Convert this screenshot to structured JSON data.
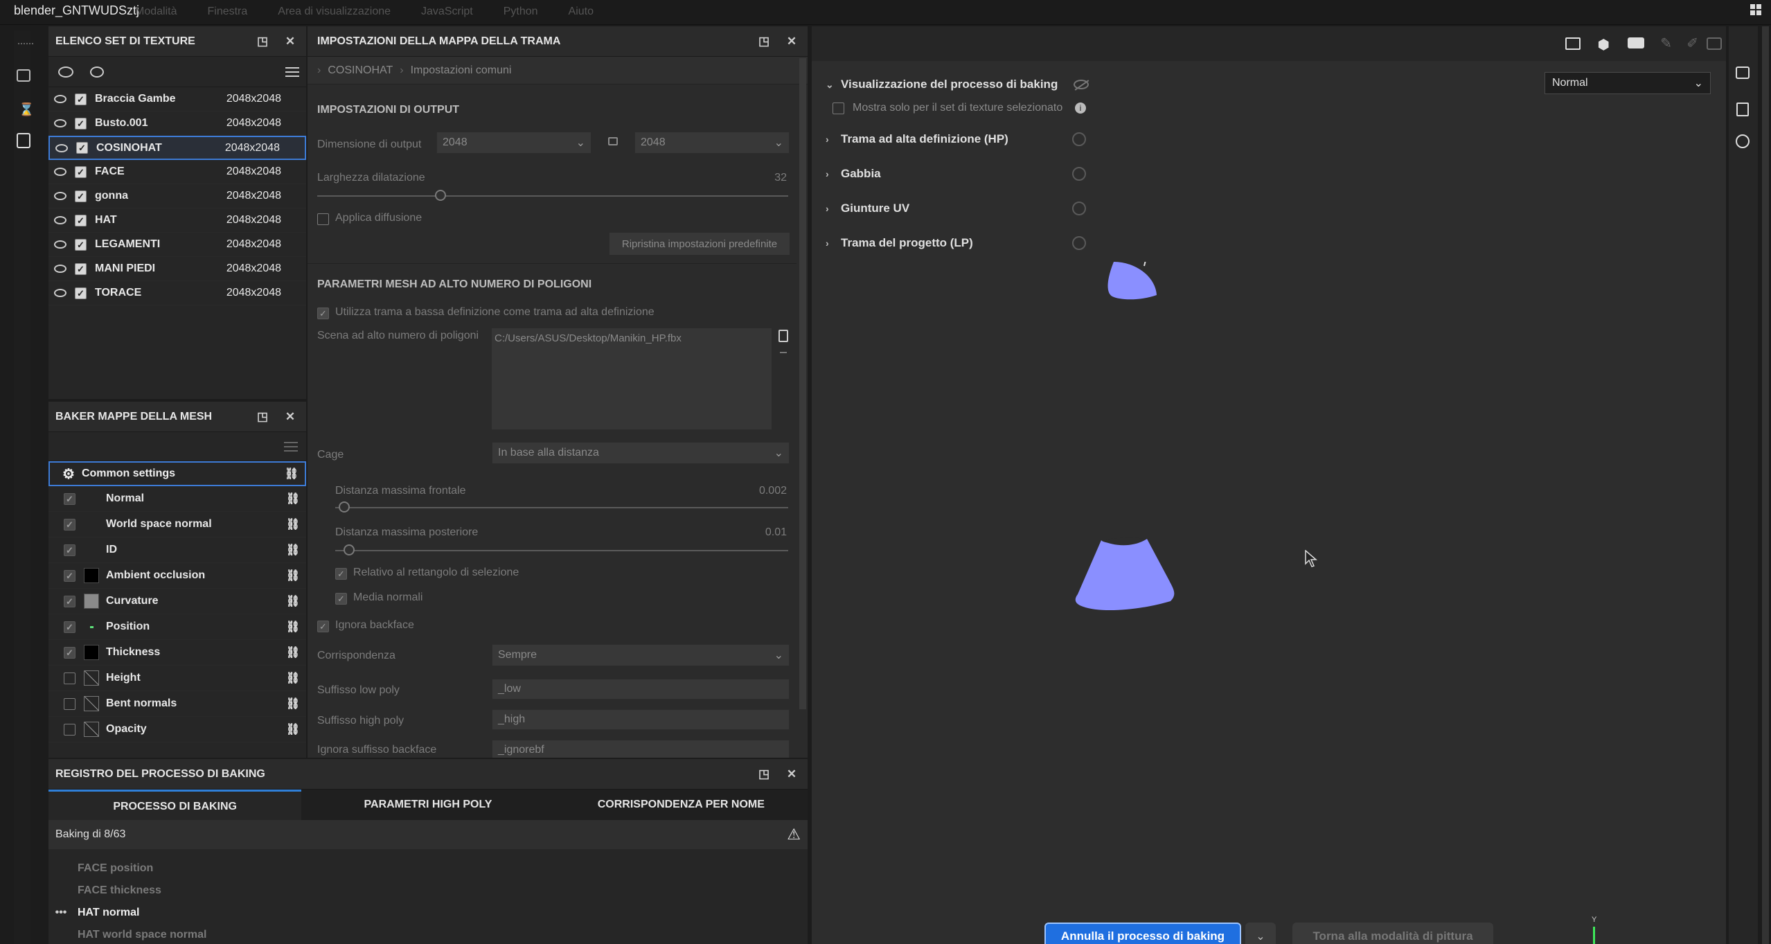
{
  "window": {
    "title": "blender_GNTWUDSztj",
    "menu": [
      "Modalità",
      "Finestra",
      "Area di visualizzazione",
      "JavaScript",
      "Python",
      "Aiuto"
    ]
  },
  "texture_sets": {
    "title": "ELENCO SET DI TEXTURE",
    "items": [
      {
        "name": "Braccia Gambe",
        "res": "2048x2048",
        "selected": false
      },
      {
        "name": "Busto.001",
        "res": "2048x2048",
        "selected": false
      },
      {
        "name": "COSINOHAT",
        "res": "2048x2048",
        "selected": true
      },
      {
        "name": "FACE",
        "res": "2048x2048",
        "selected": false
      },
      {
        "name": "gonna",
        "res": "2048x2048",
        "selected": false
      },
      {
        "name": "HAT",
        "res": "2048x2048",
        "selected": false
      },
      {
        "name": "LEGAMENTI",
        "res": "2048x2048",
        "selected": false
      },
      {
        "name": "MANI PIEDI",
        "res": "2048x2048",
        "selected": false
      },
      {
        "name": "TORACE",
        "res": "2048x2048",
        "selected": false
      }
    ]
  },
  "baker": {
    "title": "BAKER MAPPE DELLA MESH",
    "common": "Common settings",
    "maps": [
      {
        "name": "Normal",
        "checked": true,
        "swatch": ""
      },
      {
        "name": "World space normal",
        "checked": true,
        "swatch": ""
      },
      {
        "name": "ID",
        "checked": true,
        "swatch": ""
      },
      {
        "name": "Ambient occlusion",
        "checked": true,
        "swatch": "#000000"
      },
      {
        "name": "Curvature",
        "checked": true,
        "swatch": "#8a8a8a"
      },
      {
        "name": "Position",
        "checked": true,
        "swatch": "dot"
      },
      {
        "name": "Thickness",
        "checked": true,
        "swatch": "#000000"
      },
      {
        "name": "Height",
        "checked": false,
        "swatch": "slash"
      },
      {
        "name": "Bent normals",
        "checked": false,
        "swatch": "slash"
      },
      {
        "name": "Opacity",
        "checked": false,
        "swatch": "slash"
      }
    ]
  },
  "settings": {
    "title": "IMPOSTAZIONI DELLA MAPPA DELLA TRAMA",
    "breadcrumb": [
      "COSINOHAT",
      "Impostazioni comuni"
    ],
    "output_header": "IMPOSTAZIONI DI OUTPUT",
    "output_size_label": "Dimensione di output",
    "output_size_w": "2048",
    "output_size_h": "2048",
    "dilation_label": "Larghezza dilatazione",
    "dilation_value": "32",
    "dilation_fraction": 0.262,
    "diffusion_label": "Applica diffusione",
    "reset_button": "Ripristina impostazioni predefinite",
    "highpoly_header": "PARAMETRI MESH AD ALTO NUMERO DI POLIGONI",
    "use_lowpoly_label": "Utilizza trama a bassa definizione come trama ad alta definizione",
    "highpoly_scene_label": "Scena ad alto numero di poligoni",
    "highpoly_scene_value": "C:/Users/ASUS/Desktop/Manikin_HP.fbx",
    "cage_label": "Cage",
    "cage_value": "In base alla distanza",
    "max_front_label": "Distanza massima frontale",
    "max_front_value": "0.002",
    "max_front_fraction": 0.02,
    "max_rear_label": "Distanza massima posteriore",
    "max_rear_value": "0.01",
    "max_rear_fraction": 0.03,
    "relative_bbox_label": "Relativo al rettangolo di selezione",
    "average_normals_label": "Media normali",
    "ignore_backface_label": "Ignora backface",
    "match_label": "Corrispondenza",
    "match_value": "Sempre",
    "lowpoly_suffix_label": "Suffisso low poly",
    "lowpoly_suffix_value": "_low",
    "highpoly_suffix_label": "Suffisso high poly",
    "highpoly_suffix_value": "_high",
    "ignore_backface_suffix_label": "Ignora suffisso backface",
    "ignore_backface_suffix_value": "_ignorebf"
  },
  "log": {
    "title": "REGISTRO DEL PROCESSO DI BAKING",
    "tabs": [
      "PROCESSO DI BAKING",
      "PARAMETRI HIGH POLY",
      "CORRISPONDENZA PER NOME"
    ],
    "status": "Baking di 8/63",
    "entries": [
      {
        "text": "FACE position",
        "current": false
      },
      {
        "text": "FACE thickness",
        "current": false
      },
      {
        "text": "HAT normal",
        "current": true
      },
      {
        "text": "HAT world space normal",
        "current": false
      }
    ]
  },
  "viewport": {
    "mode_select": "Normal",
    "tree": [
      {
        "label": "Visualizzazione del processo di baking",
        "expanded": true
      },
      {
        "label": "Trama ad alta definizione (HP)",
        "expanded": false
      },
      {
        "label": "Gabbia",
        "expanded": false
      },
      {
        "label": "Giunture UV",
        "expanded": false
      },
      {
        "label": "Trama del progetto (LP)",
        "expanded": false
      }
    ],
    "show_selected_label": "Mostra solo per il set di texture selezionato",
    "cancel_button": "Annulla il processo di baking",
    "back_button": "Torna alla modalità di pittura",
    "axis_label": "Y",
    "mesh_color": "#8a8fff"
  },
  "colors": {
    "accent": "#2f7fd8",
    "primary_button": "#1f6fe0",
    "selection_border": "#3d7bd6"
  }
}
